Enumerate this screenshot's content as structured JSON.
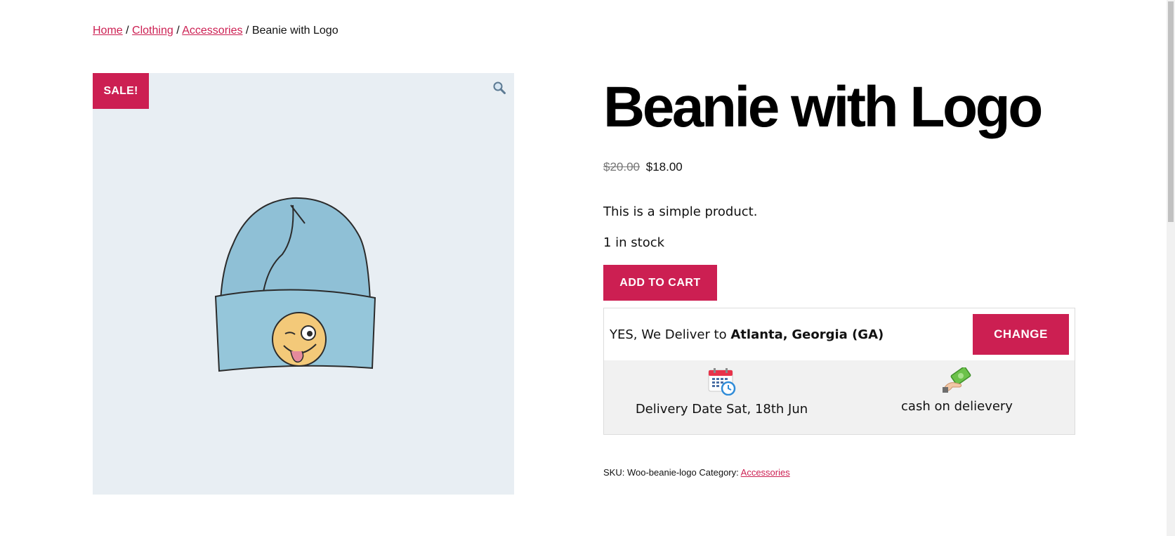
{
  "breadcrumb": {
    "items": [
      "Home",
      "Clothing",
      "Accessories"
    ],
    "current": "Beanie with Logo",
    "separator": "/"
  },
  "gallery": {
    "sale_badge": "SALE!",
    "zoom_icon": "magnifier-icon"
  },
  "product": {
    "title": "Beanie with Logo",
    "price_regular": "$20.00",
    "price_sale": "$18.00",
    "description": "This is a simple product.",
    "stock": "1 in stock",
    "add_to_cart": "ADD TO CART"
  },
  "delivery": {
    "prefix": "YES, We Deliver to",
    "city": "Atlanta",
    "comma": ",",
    "state": "Georgia (GA)",
    "change_label": "CHANGE",
    "date_label": "Delivery Date Sat, 18th Jun",
    "date_icon": "calendar-clock-icon",
    "payment_label": "cash on delievery",
    "payment_icon": "cash-hand-icon"
  },
  "meta": {
    "sku_label": "SKU:",
    "sku_value": "Woo-beanie-logo",
    "category_label": "Category:",
    "category_value": "Accessories"
  },
  "colors": {
    "accent": "#cc1f52",
    "gallery_bg": "#e8eef3",
    "delivery_bg": "#f1f1f1"
  }
}
